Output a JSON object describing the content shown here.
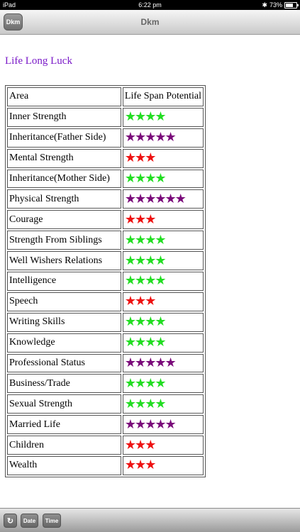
{
  "status_bar": {
    "device": "iPad",
    "time": "6:22 pm",
    "battery_text": "73%",
    "battery_level": 0.73
  },
  "nav": {
    "back_label": "Dkm",
    "title": "Dkm"
  },
  "section": {
    "title": "Life Long Luck"
  },
  "table": {
    "headers": [
      "Area",
      "Life Span Potential"
    ],
    "rows": [
      {
        "area": "Inner Strength",
        "stars": 4,
        "color": "#22dd22"
      },
      {
        "area": "Inheritance(Father Side)",
        "stars": 5,
        "color": "#7a0a7a"
      },
      {
        "area": "Mental Strength",
        "stars": 3,
        "color": "#ee1111"
      },
      {
        "area": "Inheritance(Mother Side)",
        "stars": 4,
        "color": "#22dd22"
      },
      {
        "area": "Physical Strength",
        "stars": 6,
        "color": "#7a0a7a"
      },
      {
        "area": "Courage",
        "stars": 3,
        "color": "#ee1111"
      },
      {
        "area": "Strength From Siblings",
        "stars": 4,
        "color": "#22dd22"
      },
      {
        "area": "Well Wishers Relations",
        "stars": 4,
        "color": "#22dd22"
      },
      {
        "area": "Intelligence",
        "stars": 4,
        "color": "#22dd22"
      },
      {
        "area": "Speech",
        "stars": 3,
        "color": "#ee1111"
      },
      {
        "area": "Writing Skills",
        "stars": 4,
        "color": "#22dd22"
      },
      {
        "area": "Knowledge",
        "stars": 4,
        "color": "#22dd22"
      },
      {
        "area": "Professional Status",
        "stars": 5,
        "color": "#7a0a7a"
      },
      {
        "area": "Business/Trade",
        "stars": 4,
        "color": "#22dd22"
      },
      {
        "area": "Sexual Strength",
        "stars": 4,
        "color": "#22dd22"
      },
      {
        "area": "Married Life",
        "stars": 5,
        "color": "#7a0a7a"
      },
      {
        "area": "Children",
        "stars": 3,
        "color": "#ee1111"
      },
      {
        "area": "Wealth",
        "stars": 3,
        "color": "#ee1111"
      }
    ]
  },
  "toolbar": {
    "refresh_icon": "refresh-icon",
    "date_label": "Date",
    "time_label": "Time"
  }
}
